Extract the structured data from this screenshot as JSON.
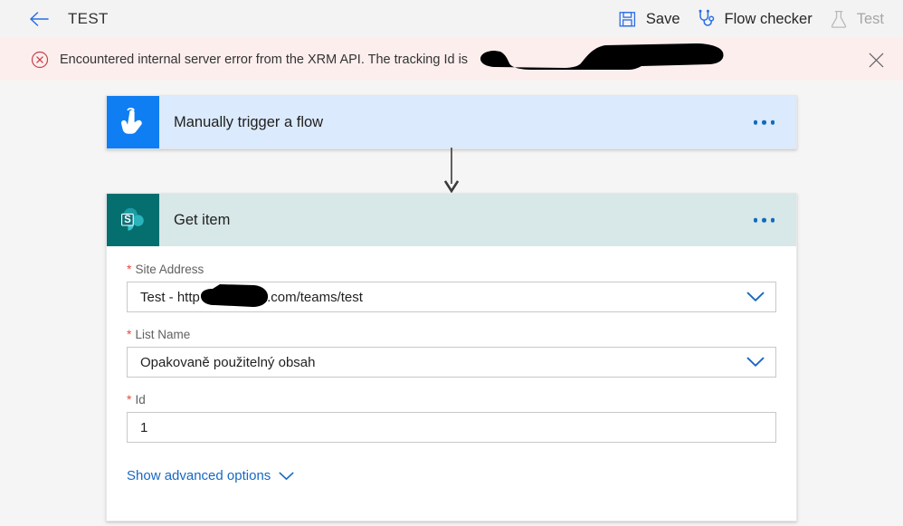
{
  "topbar": {
    "back_icon": "back-arrow-icon",
    "title": "TEST",
    "actions": [
      {
        "label": "Save",
        "icon": "save-floppy-icon",
        "enabled": true
      },
      {
        "label": "Flow checker",
        "icon": "stethoscope-icon",
        "enabled": true
      },
      {
        "label": "Test",
        "icon": "flask-icon",
        "enabled": false
      }
    ]
  },
  "error_bar": {
    "icon": "error-circle-x-icon",
    "message": "Encountered internal server error from the XRM API. The tracking Id is",
    "redacted": true,
    "close_icon": "close-icon",
    "background": "#fdeeee",
    "accent": "#c4424a"
  },
  "flow": {
    "trigger": {
      "title": "Manually trigger a flow",
      "icon": "tap-hand-icon",
      "icon_bg": "#0f7ef3",
      "header_bg": "#dbeafc",
      "menu_icon": "ellipsis-icon"
    },
    "connector": {
      "icon": "arrow-down-icon"
    },
    "action": {
      "title": "Get item",
      "icon": "sharepoint-icon",
      "icon_bg": "#056f70",
      "header_bg": "#d8e7e7",
      "menu_icon": "ellipsis-icon",
      "fields": [
        {
          "label": "Site Address",
          "required": true,
          "value": "Test - http                    sharepoint.com/teams/test",
          "type": "dropdown",
          "chevron_icon": "chevron-down-icon",
          "redacted": true
        },
        {
          "label": "List Name",
          "required": true,
          "value": "Opakovaně použitelný obsah",
          "type": "dropdown",
          "chevron_icon": "chevron-down-icon",
          "redacted": false
        },
        {
          "label": "Id",
          "required": true,
          "value": "1",
          "type": "text",
          "chevron_icon": "",
          "redacted": false
        }
      ],
      "advanced_options": {
        "label": "Show advanced options",
        "icon": "chevron-down-icon"
      }
    }
  },
  "colors": {
    "accent_blue": "#0f6cbd",
    "link_blue": "#1668c1",
    "required_red": "#e8483f",
    "canvas_bg": "#f5f5f5",
    "topbar_bg": "#f3f3f3"
  }
}
